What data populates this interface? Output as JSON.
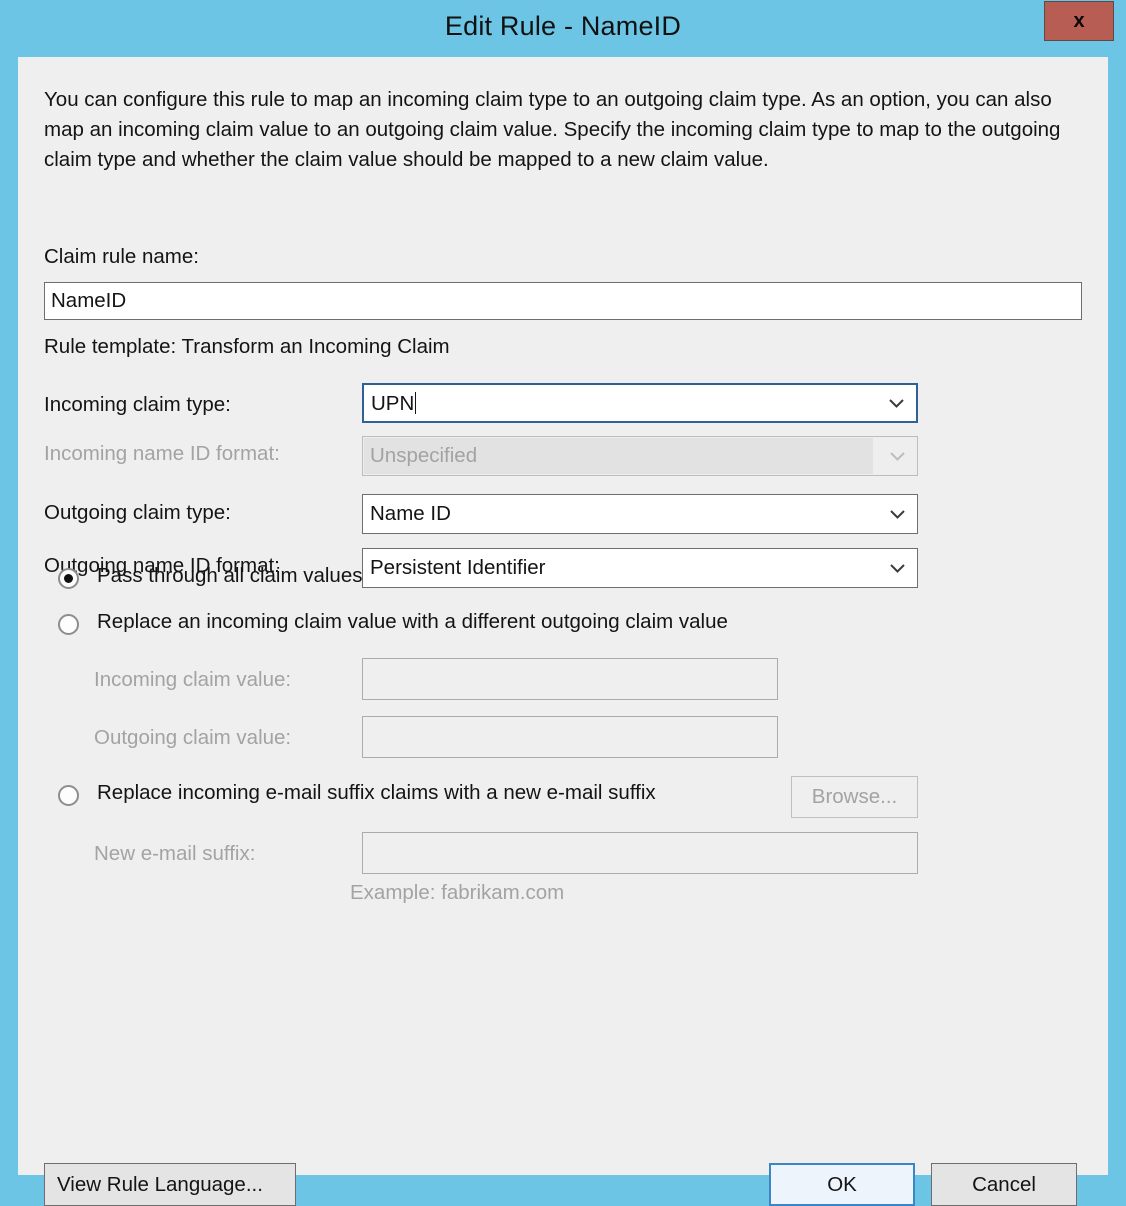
{
  "window": {
    "title": "Edit Rule - NameID",
    "close_label": "x",
    "titlebar_color": "#6dc5e6",
    "close_button_color": "#b85d53",
    "body_color": "#efefef",
    "focus_accent": "#2f6096"
  },
  "intro": {
    "text": "You can configure this rule to map an incoming claim type to an outgoing claim type. As an option, you can also map an incoming claim value to an outgoing claim value. Specify the incoming claim type to map to the outgoing claim type and whether the claim value should be mapped to a new claim value."
  },
  "form": {
    "claim_rule_name_label": "Claim rule name:",
    "claim_rule_name_value": "NameID",
    "claim_rule_name_placeholder": "",
    "rule_template": "Rule template: Transform an Incoming Claim",
    "rows": [
      {
        "label": "Incoming claim type:",
        "value": "UPN",
        "state": "focused",
        "icon": "chevron-down-icon"
      },
      {
        "label": "Incoming name ID format:",
        "value": "Unspecified",
        "state": "disabled",
        "icon": "chevron-down-icon"
      },
      {
        "label": "Outgoing claim type:",
        "value": "Name ID",
        "state": "enabled",
        "icon": "chevron-down-icon"
      },
      {
        "label": "Outgoing name ID format:",
        "value": "Persistent Identifier",
        "state": "enabled",
        "icon": "chevron-down-icon"
      }
    ]
  },
  "options": {
    "pass_through": {
      "label": "Pass through all claim values",
      "selected": true
    },
    "replace_value": {
      "label": "Replace an incoming claim value with a different outgoing claim value",
      "selected": false,
      "incoming_claim_value_label": "Incoming claim value:",
      "incoming_claim_value": "",
      "outgoing_claim_value_label": "Outgoing claim value:",
      "outgoing_claim_value": "",
      "browse_label": "Browse..."
    },
    "replace_suffix": {
      "label": "Replace incoming e-mail suffix claims with a new e-mail suffix",
      "selected": false,
      "new_suffix_label": "New e-mail suffix:",
      "new_suffix_value": "",
      "example_hint": "Example: fabrikam.com"
    }
  },
  "footer": {
    "view_rule_language_label": "View Rule Language...",
    "ok_label": "OK",
    "cancel_label": "Cancel"
  }
}
